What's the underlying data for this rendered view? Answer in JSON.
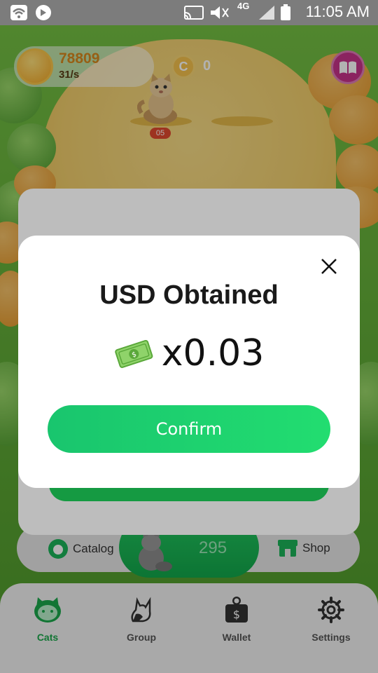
{
  "status_bar": {
    "time": "11:05 AM",
    "network": "4G",
    "icons": [
      "wifi-icon",
      "shield-app-icon",
      "cast-icon",
      "mute-icon",
      "signal-icon",
      "battery-icon"
    ]
  },
  "hud": {
    "coins": "78809",
    "coin_rate": "31/s",
    "currency_symbol": "C",
    "currency_count": "0"
  },
  "cat_level": "05",
  "game_bar": {
    "catalog_label": "Catalog",
    "shop_label": "Shop",
    "buy_cat_count": "295"
  },
  "tabs": [
    {
      "label": "Cats",
      "icon": "cat-face-icon",
      "active": true
    },
    {
      "label": "Group",
      "icon": "cat-silhouette-icon",
      "active": false
    },
    {
      "label": "Wallet",
      "icon": "wallet-icon",
      "active": false
    },
    {
      "label": "Settings",
      "icon": "gear-icon",
      "active": false
    }
  ],
  "dialog": {
    "title": "USD Obtained",
    "amount": "x0.03",
    "confirm_label": "Confirm"
  },
  "colors": {
    "accent_green": "#1aa84b",
    "confirm_green": "#22dd70",
    "coin_orange": "#d8891e"
  }
}
